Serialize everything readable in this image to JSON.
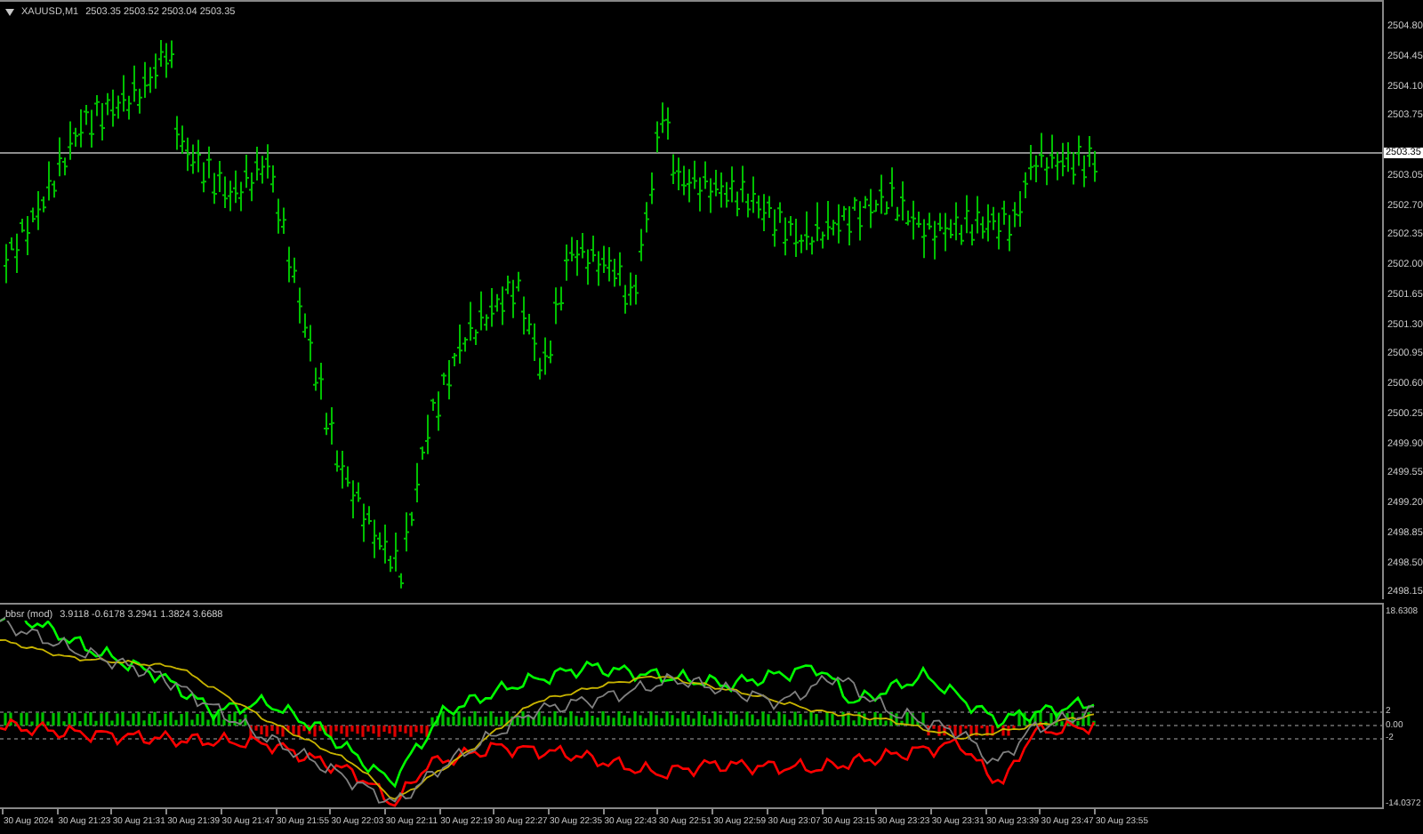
{
  "symbol_header": {
    "symbol": "XAUUSD,M1",
    "prices": "2503.35 2503.52 2503.04 2503.35"
  },
  "price_axis": {
    "ticks": [
      "2504.80",
      "2504.45",
      "2504.10",
      "2503.75",
      "2503.05",
      "2502.70",
      "2502.35",
      "2502.00",
      "2501.65",
      "2501.30",
      "2500.95",
      "2500.60",
      "2500.25",
      "2499.90",
      "2499.55",
      "2499.20",
      "2498.85",
      "2498.50",
      "2498.15"
    ],
    "current_price": "2503.35"
  },
  "indicator": {
    "name": "bbsr (mod)",
    "values": "3.9118 -0.6178 3.2941 1.3824 3.6688",
    "axis_ticks": [
      "18.6308",
      "2",
      "0.00",
      "-2",
      "-14.0372"
    ]
  },
  "time_axis": [
    "30 Aug 2024",
    "30 Aug 21:23",
    "30 Aug 21:31",
    "30 Aug 21:39",
    "30 Aug 21:47",
    "30 Aug 21:55",
    "30 Aug 22:03",
    "30 Aug 22:11",
    "30 Aug 22:19",
    "30 Aug 22:27",
    "30 Aug 22:35",
    "30 Aug 22:43",
    "30 Aug 22:51",
    "30 Aug 22:59",
    "30 Aug 23:07",
    "30 Aug 23:15",
    "30 Aug 23:23",
    "30 Aug 23:31",
    "30 Aug 23:39",
    "30 Aug 23:47",
    "30 Aug 23:55"
  ]
}
